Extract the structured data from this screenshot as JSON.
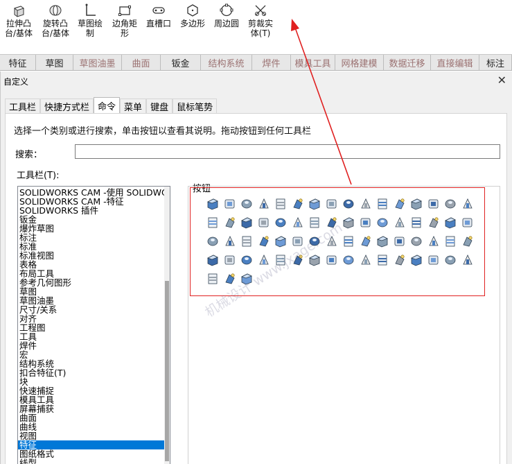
{
  "ribbon": {
    "buttons": [
      {
        "label": "拉伸凸\n台/基体",
        "icon": "extrude-boss-icon"
      },
      {
        "label": "旋转凸\n台/基体",
        "icon": "revolve-boss-icon"
      },
      {
        "label": "草图绘\n制",
        "icon": "sketch-icon"
      },
      {
        "label": "边角矩\n形",
        "icon": "corner-rectangle-icon"
      },
      {
        "label": "直槽口",
        "icon": "straight-slot-icon"
      },
      {
        "label": "多边形",
        "icon": "polygon-icon"
      },
      {
        "label": "周边圆",
        "icon": "perimeter-circle-icon"
      },
      {
        "label": "剪裁实\n体(T)",
        "icon": "trim-entities-icon"
      }
    ]
  },
  "tabs": [
    {
      "label": "特征",
      "dim": false
    },
    {
      "label": "草图",
      "dim": false
    },
    {
      "label": "草图油墨",
      "dim": true
    },
    {
      "label": "曲面",
      "dim": true
    },
    {
      "label": "钣金",
      "dim": false
    },
    {
      "label": "结构系统",
      "dim": true
    },
    {
      "label": "焊件",
      "dim": true
    },
    {
      "label": "模具工具",
      "dim": true
    },
    {
      "label": "网格建模",
      "dim": true
    },
    {
      "label": "数据迁移",
      "dim": true
    },
    {
      "label": "直接编辑",
      "dim": true
    },
    {
      "label": "标注",
      "dim": false
    }
  ],
  "dialog": {
    "title": "自定义",
    "close": "✕",
    "tabs": [
      "工具栏",
      "快捷方式栏",
      "命令",
      "菜单",
      "键盘",
      "鼠标笔势"
    ],
    "active_tab": "命令",
    "hint": "选择一个类别或进行搜索，单击按钮以查看其说明。拖动按钮到任何工具栏",
    "search_label": "搜索：",
    "search_value": "",
    "toolbars_label": "工具栏(T):",
    "buttons_label": "按钮",
    "categories": [
      "SOLIDWORKS CAM -使用 SOLIDWORKS 社",
      "SOLIDWORKS CAM -特征",
      "SOLIDWORKS 插件",
      "钣金",
      "爆炸草图",
      "标注",
      "标准",
      "标准视图",
      "表格",
      "布局工具",
      "参考几何图形",
      "草图",
      "草图油墨",
      "尺寸/关系",
      "对齐",
      "工程图",
      "工具",
      "焊件",
      "宏",
      "结构系统",
      "扣合特征(T)",
      "块",
      "快速捕捉",
      "模具工具",
      "屏幕捕获",
      "曲面",
      "曲线",
      "视图",
      "特征",
      "图纸格式",
      "线型"
    ],
    "selected_category": "特征"
  },
  "watermark": "机械设计 www.jxage.com",
  "colors": {
    "accent": "#0078d7",
    "annotation": "#e02020",
    "icon_blue": "#4a7fc1",
    "icon_gray": "#9aa3ad"
  }
}
